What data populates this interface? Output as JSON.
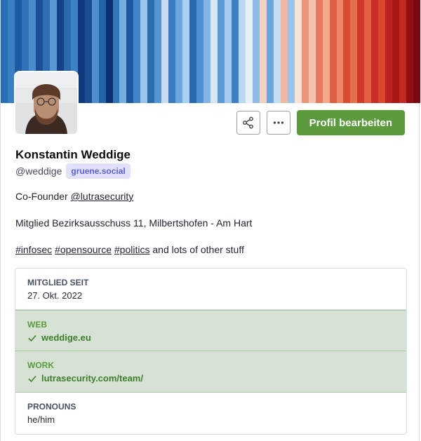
{
  "profile": {
    "display_name": "Konstantin Weddige",
    "handle": "@weddige",
    "server": "gruene.social",
    "bio": {
      "line1_prefix": "Co-Founder ",
      "line1_mention": "@lutrasecurity",
      "line2": "Mitglied Bezirksausschuss 11, Milbertshofen - Am Hart",
      "hashtag1": "#infosec",
      "hashtag2": "#opensource",
      "hashtag3": "#politics",
      "line3_suffix": " and lots of other stuff"
    }
  },
  "actions": {
    "share_icon": "share-icon",
    "more_icon": "more-icon",
    "edit_label": "Profil bearbeiten"
  },
  "fields": {
    "member_since_label": "MITGLIED SEIT",
    "member_since_value": "27. Okt. 2022",
    "web_label": "WEB",
    "web_value": "weddige.eu",
    "work_label": "WORK",
    "work_value": "lutrasecurity.com/team/",
    "pronouns_label": "PRONOUNS",
    "pronouns_value": "he/him"
  },
  "colors": {
    "primary_button": "#5b9a3d",
    "verified_bg": "#d5e2d4",
    "badge_bg": "#e1e1fb",
    "badge_text": "#5a5fd1"
  }
}
